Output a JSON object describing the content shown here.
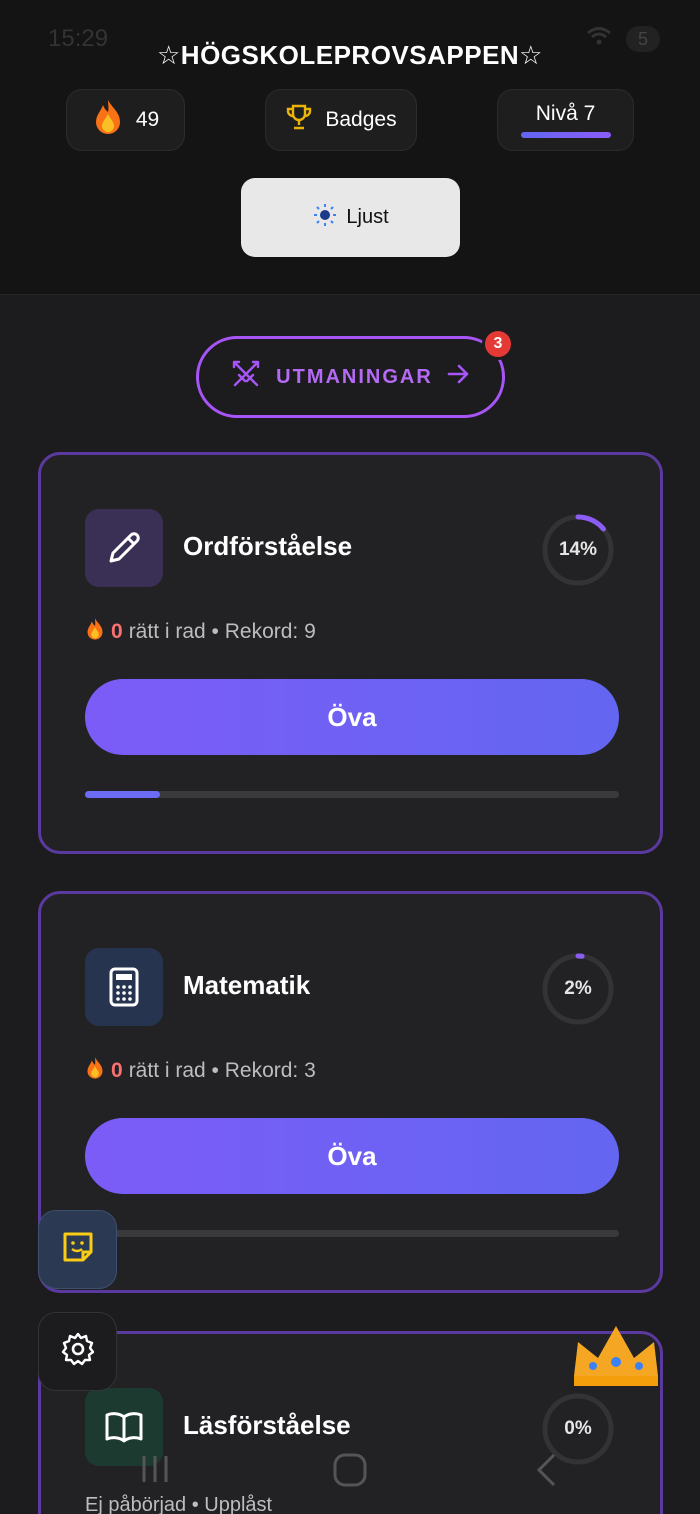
{
  "status_bar": {
    "time": "15:29",
    "battery": "5"
  },
  "header": {
    "title": "☆HÖGSKOLEPROVSAPPEN☆",
    "streak": {
      "icon": "fire-icon",
      "count": "49"
    },
    "badges": {
      "icon": "trophy-icon",
      "label": "Badges"
    },
    "level": {
      "label": "Nivå 7",
      "progress": 1.0
    },
    "theme_toggle": {
      "icon": "sun-icon",
      "label": "Ljust"
    }
  },
  "challenges": {
    "label": "UTMANINGAR",
    "icon": "swords-icon",
    "badge_count": "3"
  },
  "subjects": [
    {
      "name": "Ordförståelse",
      "icon": "pencil-icon",
      "percent_label": "14%",
      "percent": 14,
      "streak": "0",
      "streak_text": "rätt i rad • Rekord: 9",
      "button": "Öva",
      "progress": 0.14
    },
    {
      "name": "Matematik",
      "icon": "calculator-icon",
      "percent_label": "2%",
      "percent": 2,
      "streak": "0",
      "streak_text": "rätt i rad • Rekord: 3",
      "button": "Öva",
      "progress": 0.02
    },
    {
      "name": "Läsförståelse",
      "icon": "book-icon",
      "percent_label": "0%",
      "percent": 0,
      "status": "Ej påbörjad • Upplåst"
    }
  ],
  "floating": {
    "chat_icon": "smiley-note-icon",
    "settings_icon": "gear-icon",
    "crown_icon": "crown-icon"
  },
  "colors": {
    "accent": "#a855f7",
    "button": "#6d5ff5",
    "card_border": "#5b3aa0",
    "streak_zero": "#f87171"
  }
}
